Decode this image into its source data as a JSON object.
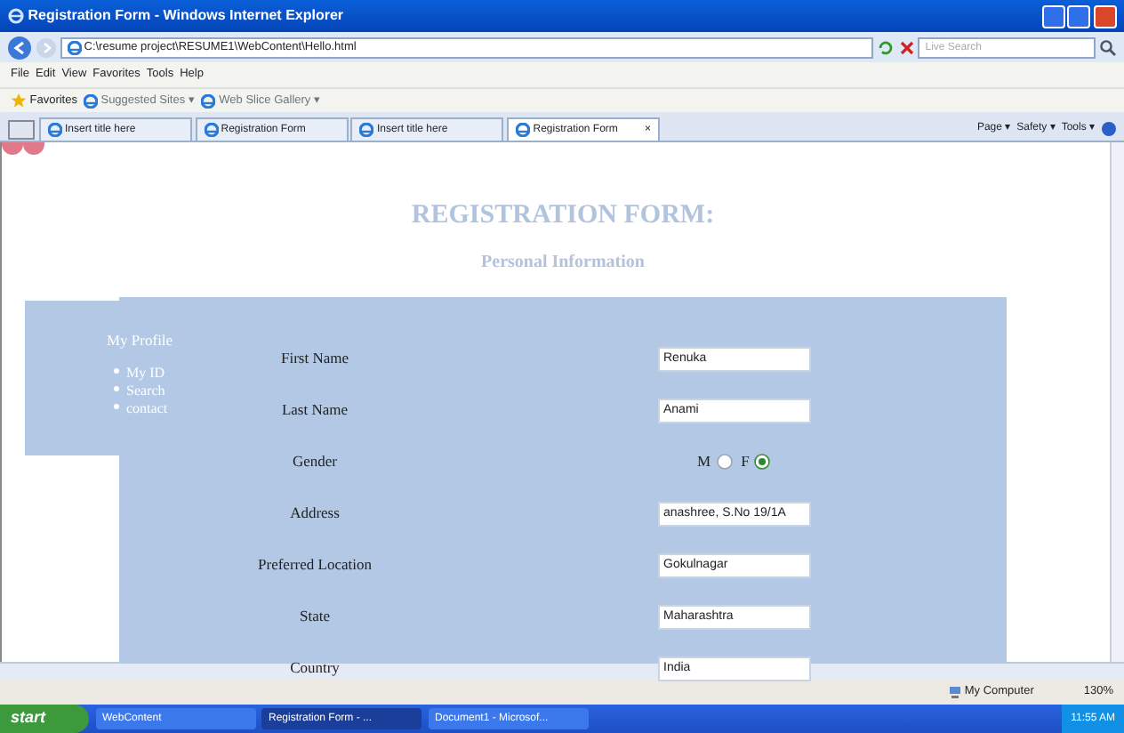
{
  "window": {
    "title": "Registration Form - Windows Internet Explorer"
  },
  "address_bar": {
    "url": "C:\\resume project\\RESUME1\\WebContent\\Hello.html"
  },
  "search": {
    "placeholder": "Live Search"
  },
  "menu": [
    "File",
    "Edit",
    "View",
    "Favorites",
    "Tools",
    "Help"
  ],
  "favorites_bar": {
    "label": "Favorites",
    "links": [
      "Suggested Sites ▾",
      "Web Slice Gallery ▾"
    ]
  },
  "tabs": [
    {
      "label": "Insert title here",
      "selected": false
    },
    {
      "label": "Registration Form",
      "selected": false
    },
    {
      "label": "Insert title here",
      "selected": false
    },
    {
      "label": "Registration Form",
      "selected": true,
      "close": "×"
    }
  ],
  "command_bar": [
    "Page ▾",
    "Safety ▾",
    "Tools ▾"
  ],
  "page": {
    "title": "REGISTRATION FORM:",
    "subtitle": "Personal Information",
    "sidebar": {
      "title": "My Profile",
      "links": [
        "My ID",
        "Search",
        "contact"
      ]
    },
    "fields": [
      {
        "kind": "text",
        "label": "First Name",
        "value": "Renuka"
      },
      {
        "kind": "text",
        "label": "Last Name",
        "value": "Anami"
      },
      {
        "kind": "radio",
        "label": "Gender",
        "options": [
          {
            "label": "M",
            "selected": false
          },
          {
            "label": "F",
            "selected": true
          }
        ]
      },
      {
        "kind": "text",
        "label": "Address",
        "value": "anashree, S.No 19/1A"
      },
      {
        "kind": "text",
        "label": "Preferred Location",
        "value": "Gokulnagar"
      },
      {
        "kind": "text",
        "label": "State",
        "value": "Maharashtra"
      },
      {
        "kind": "text",
        "label": "Country",
        "value": "India"
      }
    ]
  },
  "status_bar": {
    "zone": "My Computer",
    "zoom": "130%"
  },
  "taskbar": {
    "start": "start",
    "items": [
      {
        "label": "WebContent",
        "selected": false
      },
      {
        "label": "Registration Form - ...",
        "selected": true
      },
      {
        "label": "Document1 - Microsof...",
        "selected": false
      }
    ],
    "clock": "11:55 AM"
  }
}
